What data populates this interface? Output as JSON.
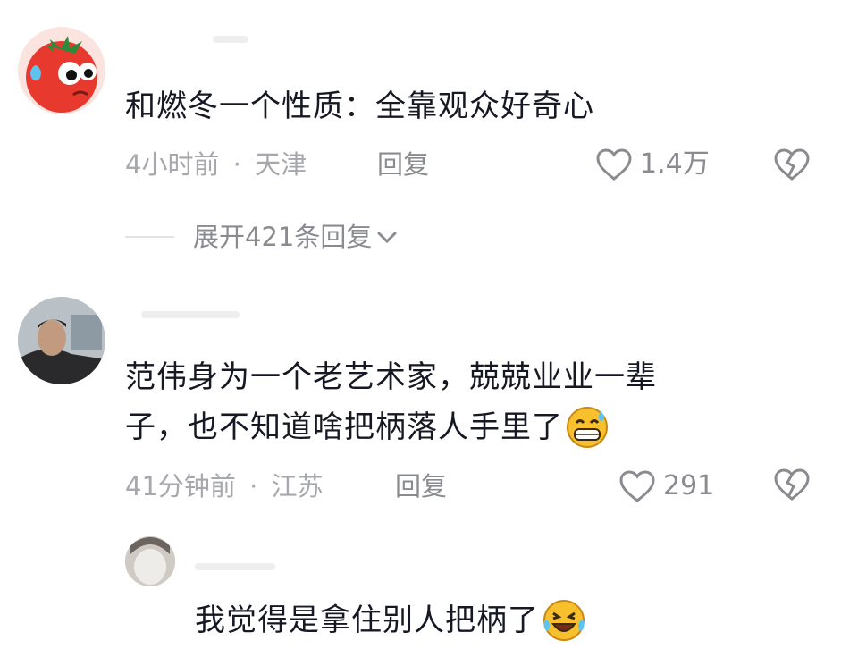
{
  "comments": [
    {
      "text": "和燃冬一个性质：全靠观众好奇心",
      "time": "4小时前",
      "location": "天津",
      "reply_label": "回复",
      "likes": "1.4万",
      "expand_label": "展开421条回复"
    },
    {
      "text_line1": "范伟身为一个老艺术家，兢兢业业一辈",
      "text_line2": "子，也不知道啥把柄落人手里了",
      "time": "41分钟前",
      "location": "江苏",
      "reply_label": "回复",
      "likes": "291",
      "reply": {
        "text": "我觉得是拿住别人把柄了"
      }
    }
  ],
  "separator": "·",
  "colors": {
    "text": "#161823",
    "meta": "#a7a8ad",
    "icon": "#8a8b90",
    "tomato": "#e8392f"
  }
}
